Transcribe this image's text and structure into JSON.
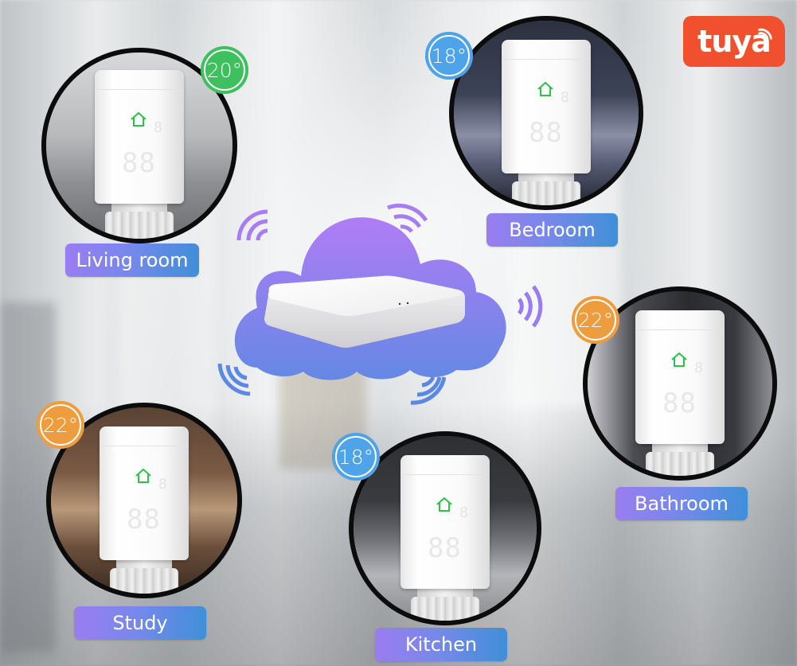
{
  "brand": {
    "logo_text": "tuya",
    "logo_icon": "wifi-signal-icon",
    "color": "#f1502f"
  },
  "hub": {
    "name": "Zigbee gateway hub",
    "cloud_icon": "cloud-icon",
    "signal_icon": "wifi-signal-icon",
    "cloud_colors": [
      "#b07cf5",
      "#6b87e6"
    ]
  },
  "rooms": [
    {
      "id": "living-room",
      "label": "Living room",
      "temperature": "20°",
      "badge_color": "#3fc05e",
      "scene_colors": [
        "#8d8f93",
        "#c9cacc",
        "#6c6e71"
      ]
    },
    {
      "id": "bedroom",
      "label": "Bedroom",
      "temperature": "18°",
      "badge_color": "#4fa3e8",
      "scene_colors": [
        "#2c3140",
        "#555b73",
        "#8a8fa6"
      ]
    },
    {
      "id": "bathroom",
      "label": "Bathroom",
      "temperature": "22°",
      "badge_color": "#ee9d3e",
      "scene_colors": [
        "#2a2b2f",
        "#4b4c52",
        "#cfcfd3"
      ]
    },
    {
      "id": "study",
      "label": "Study",
      "temperature": "22°",
      "badge_color": "#ee9d3e",
      "scene_colors": [
        "#3b2b22",
        "#7a5a44",
        "#b89878"
      ]
    },
    {
      "id": "kitchen",
      "label": "Kitchen",
      "temperature": "18°",
      "badge_color": "#4fa3e8",
      "scene_colors": [
        "#3a3b3f",
        "#6c6e73",
        "#b3b5b9"
      ]
    }
  ],
  "thermostat": {
    "display_digits": "88",
    "small_digit": "8",
    "mode_icon": "house-icon",
    "mode_color": "#2fc24a",
    "top_symbols": [
      "−",
      "⁂",
      "+"
    ]
  }
}
